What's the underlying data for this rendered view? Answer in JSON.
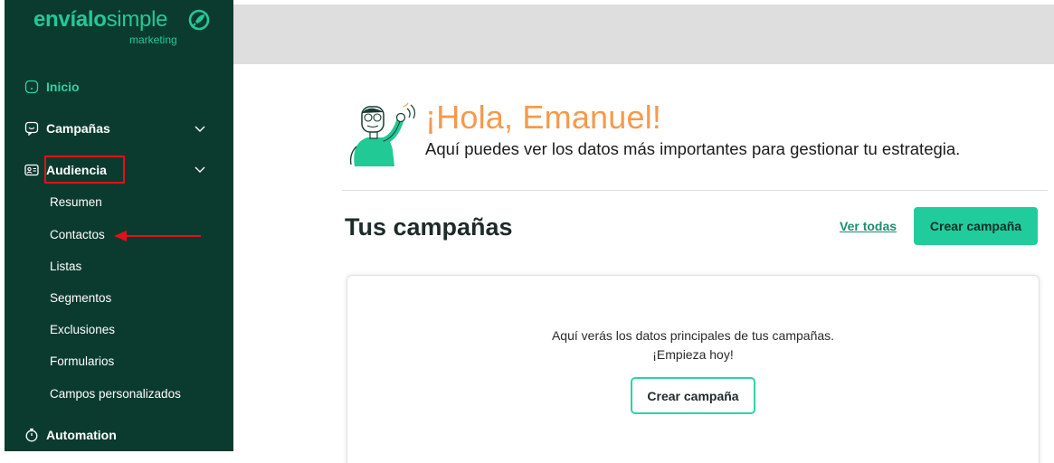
{
  "brand": {
    "name_part1": "envíalo",
    "name_part2": "simple",
    "tagline": "marketing",
    "logo_icon": "spiral-rocket-icon",
    "accent_color": "#22c99a",
    "sidebar_bg": "#0b3b2e"
  },
  "sidebar": {
    "items": [
      {
        "label": "Inicio",
        "icon": "home-icon",
        "active": true
      },
      {
        "label": "Campañas",
        "icon": "message-icon",
        "expandable": true
      },
      {
        "label": "Audiencia",
        "icon": "contact-card-icon",
        "expandable": true,
        "expanded": true
      },
      {
        "label": "Automation",
        "icon": "timer-icon"
      }
    ],
    "audiencia_subitems": [
      "Resumen",
      "Contactos",
      "Listas",
      "Segmentos",
      "Exclusiones",
      "Formularios",
      "Campos personalizados"
    ]
  },
  "annotation": {
    "highlight_color": "#e2101b",
    "highlighted_item": "Audiencia",
    "arrow_target": "Contactos"
  },
  "hero": {
    "title": "¡Hola, Emanuel!",
    "subtitle": "Aquí puedes ver los datos más importantes para gestionar tu estrategia.",
    "title_color": "#f59a4c"
  },
  "campaigns": {
    "title": "Tus campañas",
    "view_all": "Ver todas",
    "create_button": "Crear campaña",
    "empty_line1": "Aquí verás los datos principales de tus campañas.",
    "empty_line2": "¡Empieza hoy!",
    "empty_button": "Crear campaña"
  }
}
